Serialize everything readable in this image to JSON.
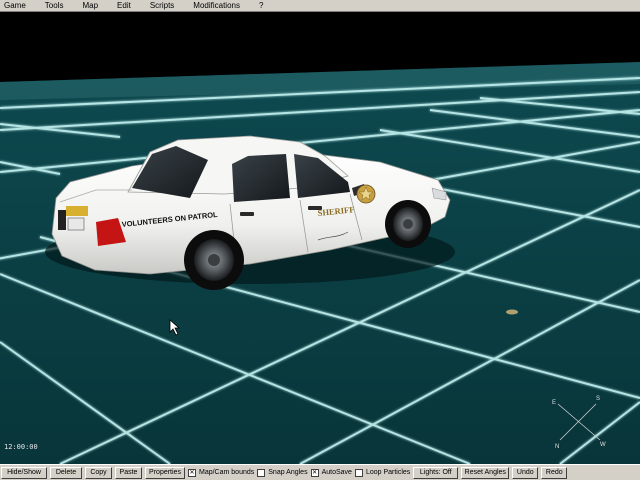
{
  "menu": [
    "Game",
    "Tools",
    "Map",
    "Edit",
    "Scripts",
    "Modifications",
    "?"
  ],
  "car": {
    "door_text": "VOLUNTEERS ON PATROL",
    "badge_text": "SHERIFF",
    "body_color": "#f4f4f2"
  },
  "compass": {
    "n": "N",
    "s": "S",
    "e": "E",
    "w": "W"
  },
  "clock": "12:00:00",
  "toolbar": {
    "hide_show": "Hide/Show",
    "delete": "Delete",
    "copy": "Copy",
    "paste": "Paste",
    "properties": "Properties",
    "map_cam_bounds": "Map/Cam bounds",
    "snap_angles": "Snap Angles",
    "autosave": "AutoSave",
    "loop_particles": "Loop Particles",
    "lights": "Lights: Off",
    "reset_angles": "Reset Angles",
    "undo": "Undo",
    "redo": "Redo"
  },
  "checkbox_states": {
    "map_cam_bounds": true,
    "snap_angles": false,
    "autosave": true,
    "loop_particles": false
  },
  "colors": {
    "ground": "#0b3f44",
    "grid": "#bff2f2",
    "sky": "#000000",
    "ui_gray": "#d4d0c8"
  }
}
